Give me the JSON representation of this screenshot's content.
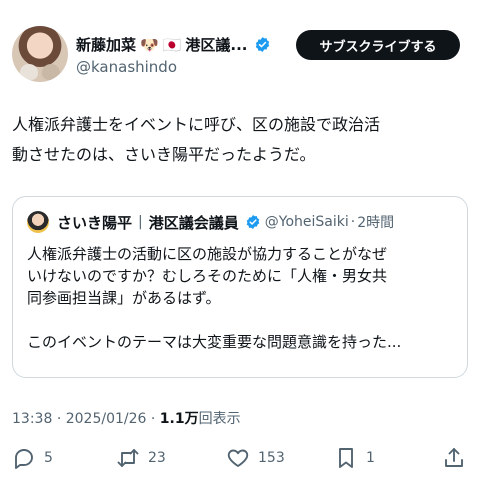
{
  "author": {
    "display_name": "新藤加菜",
    "emoji_dog": "🐶",
    "emoji_flag": "🇯🇵",
    "title_suffix": "港区議...",
    "handle": "@kanashindo"
  },
  "subscribe_label": "サブスクライブする",
  "tweet": {
    "line1": "人権派弁護士をイベントに呼び、区の施設で政治活",
    "line2": "動させたのは、さいき陽平だったようだ。"
  },
  "quote": {
    "name": "さいき陽平",
    "separator": "|",
    "title": "港区議会議員",
    "handle": "@YoheiSaiki",
    "dot": "·",
    "time": "2時間",
    "line1": "人権派弁護士の活動に区の施設が協力することがなぜ",
    "line2": "いけないのですか？むしろそのために「人権・男女共",
    "line3": "同参画担当課」があるはず。",
    "line4": "このイベントのテーマは大変重要な問題意識を持った..."
  },
  "meta": {
    "time": "13:38",
    "dot1": "·",
    "date": "2025/01/26",
    "dot2": "·",
    "views": "1.1万",
    "views_label": "回表示"
  },
  "actions": {
    "replies": "5",
    "reposts": "23",
    "likes": "153",
    "bookmarks": "1"
  },
  "colors": {
    "accent": "#1d9bf0",
    "text": "#0f1419",
    "muted": "#536471",
    "border": "#cfd9de"
  }
}
